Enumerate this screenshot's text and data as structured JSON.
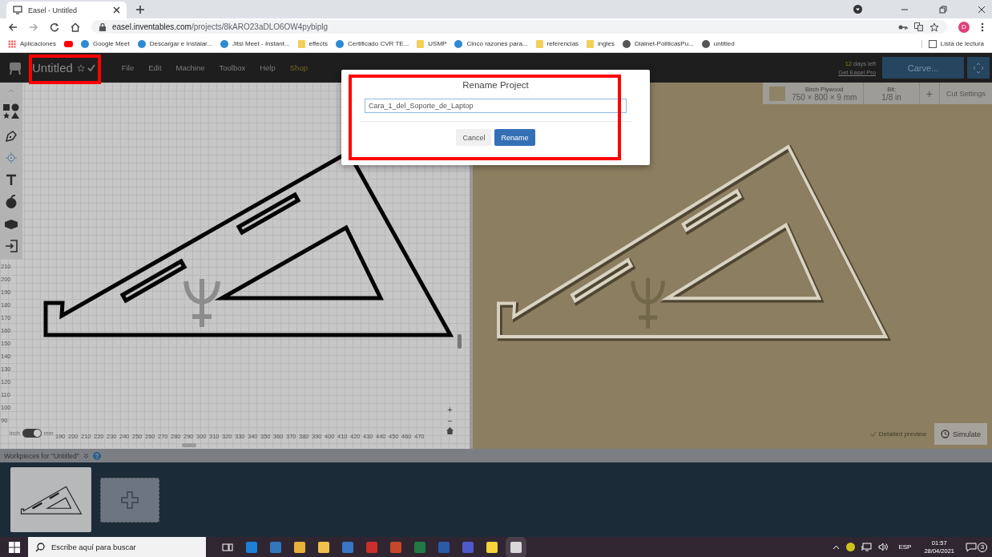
{
  "browser": {
    "tab": {
      "title": "Easel - Untitled",
      "selected": true
    },
    "url": {
      "host": "easel.inventables.com",
      "path": "/projects/8kARO23aDLO6OW4pybiplg"
    },
    "profile_initial": "D",
    "bookmarks": [
      {
        "kind": "apps",
        "label": "Aplicaciones"
      },
      {
        "kind": "video"
      },
      {
        "kind": "site",
        "label": "Google Meet"
      },
      {
        "kind": "site",
        "label": "Descargar e Instalar..."
      },
      {
        "kind": "site",
        "label": "Jitsi Meet - Instant..."
      },
      {
        "kind": "folder",
        "label": "effects"
      },
      {
        "kind": "site",
        "label": "Certificado CVR TE..."
      },
      {
        "kind": "folder",
        "label": "USMP"
      },
      {
        "kind": "site",
        "label": "Cinco razones para..."
      },
      {
        "kind": "folder",
        "label": "referencias"
      },
      {
        "kind": "folder",
        "label": "ingles"
      },
      {
        "kind": "globe",
        "label": "Dialnet-PoliticasPu..."
      },
      {
        "kind": "globe",
        "label": "untitled"
      }
    ],
    "reading_list": "Lista de lectura"
  },
  "app": {
    "project_title": "Untitled",
    "menu": [
      "File",
      "Edit",
      "Machine",
      "Toolbox",
      "Help",
      "Shop"
    ],
    "trial_days": "12",
    "trial_text": "days left",
    "upgrade_link": "Get Easel Pro",
    "carve_button": "Carve...",
    "material": {
      "name": "Birch Plywood",
      "size": "750 × 800 × 9 mm"
    },
    "bit": {
      "label": "Bit:",
      "value": "1/8 in"
    },
    "add_button": "+",
    "cut_settings": "Cut Settings",
    "left_ruler": [
      "210",
      "200",
      "190",
      "180",
      "170",
      "160",
      "150",
      "140",
      "130",
      "120",
      "110",
      "100",
      "90"
    ],
    "bottom_ruler": [
      "190",
      "200",
      "210",
      "220",
      "230",
      "240",
      "250",
      "260",
      "270",
      "280",
      "290",
      "300",
      "310",
      "320",
      "330",
      "340",
      "350",
      "360",
      "370",
      "380",
      "390",
      "400",
      "410",
      "420",
      "430",
      "440",
      "450",
      "460",
      "470"
    ],
    "unit_toggle": {
      "left": "inch",
      "right": "mm",
      "on": true
    },
    "zoom_controls": [
      "+",
      "−"
    ],
    "detailed_preview": {
      "label": "Detailed preview",
      "checked": true
    },
    "simulate_button": "Simulate",
    "workpieces_label": "Workpieces for \"Untitled\"",
    "workpieces": [
      {
        "selected": true
      }
    ]
  },
  "dialog": {
    "title": "Rename Project",
    "value": "Cara_1_del_Soporte_de_Laptop",
    "buttons": [
      {
        "label": "Cancel",
        "primary": false
      },
      {
        "label": "Rename",
        "primary": true
      }
    ]
  },
  "taskbar": {
    "search_placeholder": "Escribe aquí para buscar",
    "language": "ESP",
    "time": "01:57",
    "date": "28/04/2021",
    "notifications": "3"
  }
}
